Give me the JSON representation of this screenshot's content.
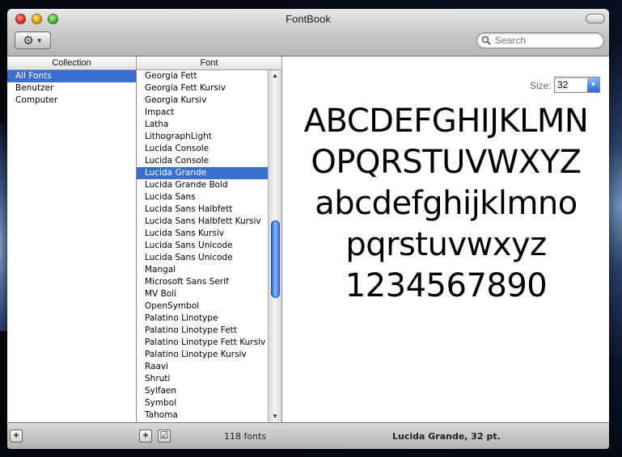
{
  "window": {
    "title": "FontBook"
  },
  "toolbar": {
    "action_icon": "gear-icon",
    "search_placeholder": "Search"
  },
  "collection_pane": {
    "header": "Collection",
    "items": [
      "All Fonts",
      "Benutzer",
      "Computer"
    ],
    "selected": "All Fonts"
  },
  "font_pane": {
    "header": "Font",
    "items": [
      "Georgia Fett",
      "Georgia Fett Kursiv",
      "Georgia Kursiv",
      "Impact",
      "Latha",
      "LithographLight",
      "Lucida Console",
      "Lucida Console",
      "Lucida Grande",
      "Lucida Grande Bold",
      "Lucida Sans",
      "Lucida Sans Halbfett",
      "Lucida Sans Halbfett Kursiv",
      "Lucida Sans Kursiv",
      "Lucida Sans Unicode",
      "Lucida Sans Unicode",
      "Mangal",
      "Microsoft Sans Serif",
      "MV Boli",
      "OpenSymbol",
      "Palatino Linotype",
      "Palatino Linotype Fett",
      "Palatino Linotype Fett Kursiv",
      "Palatino Linotype Kursiv",
      "Raavi",
      "Shruti",
      "Sylfaen",
      "Symbol",
      "Tahoma"
    ],
    "selected": "Lucida Grande"
  },
  "preview": {
    "size_label": "Size:",
    "size_value": "32",
    "sample_lines": [
      "ABCDEFGHIJKLMN",
      "OPQRSTUVWXYZ",
      "abcdefghijklmno",
      "pqrstuvwxyz",
      "1234567890"
    ]
  },
  "bottom_bar": {
    "add_collection_label": "+",
    "add_font_label": "+",
    "validate_label": "☑",
    "font_count": "118 fonts",
    "status": "Lucida Grande, 32 pt."
  }
}
